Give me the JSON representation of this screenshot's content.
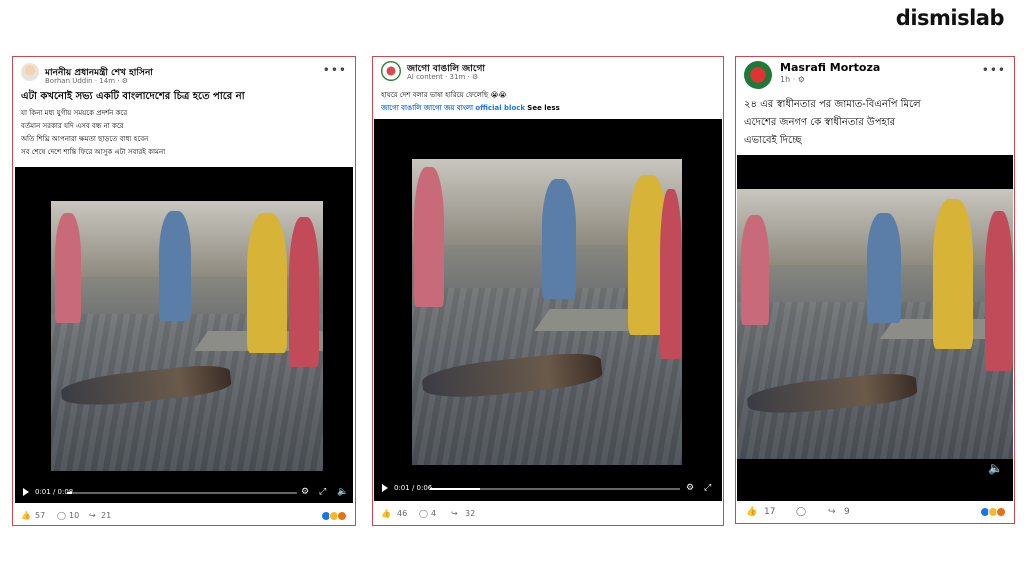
{
  "brand": "dismislab",
  "posts": [
    {
      "name": "মাননীয় প্রধানমন্ত্রী শেখ হাসিনা",
      "meta": "Borhan Uddin · 14m · ⚙",
      "headline": "এটা কখনোই সভ্য একটি বাংলাদেশের চিত্র হতে পারে না",
      "lines": [
        "যা কিনা মধ্য যুগীয় সময়কে প্রদর্শন করে",
        "বর্তমান সরকার যদি এসব বন্ধ না করে",
        "অতি শিঘ্রি আপনারা ক্ষমতা ছাড়তে বাধ্য হবেন",
        "সব শেষে দেশে শান্তি ফিরে আসুক এটা সবারই কামনা"
      ],
      "time": "0:01 / 0:08",
      "likes": "57",
      "comments": "10",
      "shares": "21",
      "progress": 0.02
    },
    {
      "name": "জাগো বাঙালি জাগো",
      "meta": "AI content · 31m · ⚙",
      "line1": "হায়রে দেশ বলার ভাষা হারিয়ে ফেলেছি 😭😭",
      "line2a": "জাগো বাঙালি জাগো জয় বাংলা",
      "line2b": "official block",
      "line2c": "See less",
      "time": "0:01 / 0:06",
      "likes": "46",
      "comments": "4",
      "shares": "32",
      "progress": 0.2
    },
    {
      "name": "Masrafi Mortoza",
      "meta": "1h · ⚙",
      "lines": [
        "২৪ এর স্বাধীনতার পর জামাত-বিএনপি মিলে",
        "এদেশের জনগণ কে স্বাধীনতার উপহার",
        "এভাবেই দিচ্ছে"
      ],
      "likes": "17",
      "shares": "9"
    }
  ],
  "colors": {
    "border": "#c94a55",
    "link": "#1b74e4",
    "fb_gray": "#65676b"
  },
  "icons": [
    "more-icon",
    "play-icon",
    "settings-icon",
    "fullscreen-icon",
    "volume-icon",
    "like-icon",
    "comment-icon",
    "share-icon"
  ]
}
